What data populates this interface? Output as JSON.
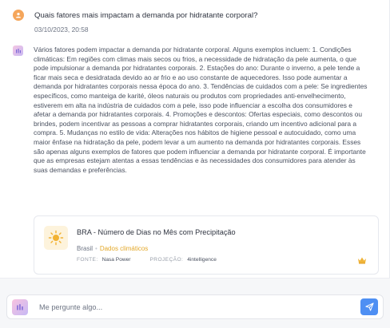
{
  "question": {
    "text": "Quais fatores mais impactam a demanda por hidratante corporal?",
    "timestamp": "03/10/2023, 20:58",
    "avatar_icon": "user-icon"
  },
  "answer": {
    "avatar_icon": "brand-logo-icon",
    "text": "Vários fatores podem impactar a demanda por hidratante corporal. Alguns exemplos incluem: 1. Condições climáticas: Em regiões com climas mais secos ou frios, a necessidade de hidratação da pele aumenta, o que pode impulsionar a demanda por hidratantes corporais. 2. Estações do ano: Durante o inverno, a pele tende a ficar mais seca e desidratada devido ao ar frio e ao uso constante de aquecedores. Isso pode aumentar a demanda por hidratantes corporais nessa época do ano. 3. Tendências de cuidados com a pele: Se ingredientes específicos, como manteiga de karité, óleos naturais ou produtos com propriedades anti-envelhecimento, estiverem em alta na indústria de cuidados com a pele, isso pode influenciar a escolha dos consumidores e afetar a demanda por hidratantes corporais. 4. Promoções e descontos: Ofertas especiais, como descontos ou brindes, podem incentivar as pessoas a comprar hidratantes corporais, criando um incentivo adicional para a compra. 5. Mudanças no estilo de vida: Alterações nos hábitos de higiene pessoal e autocuidado, como uma maior ênfase na hidratação da pele, podem levar a um aumento na demanda por hidratantes corporais. Esses são apenas alguns exemplos de fatores que podem influenciar a demanda por hidratante corporal. É importante que as empresas estejam atentas a essas tendências e às necessidades dos consumidores para atender às suas demandas e preferências."
  },
  "dataset_card": {
    "icon": "sun-icon",
    "title": "BRA - Número de Dias no Mês com Precipitação",
    "country": "Brasil",
    "separator": "•",
    "category": "Dados climáticos",
    "source_label": "FONTE:",
    "source_value": "Nasa Power",
    "projection_label": "PROJEÇÃO:",
    "projection_value": "4intelligence",
    "badge_icon": "crown-icon"
  },
  "input": {
    "placeholder": "Me pergunte algo...",
    "value": "",
    "send_icon": "send-icon"
  },
  "colors": {
    "user_avatar": "#f5a65b",
    "accent_blue": "#4e8ff3",
    "category_gold": "#e3a82a",
    "card_icon_bg": "#fdf3dc"
  }
}
